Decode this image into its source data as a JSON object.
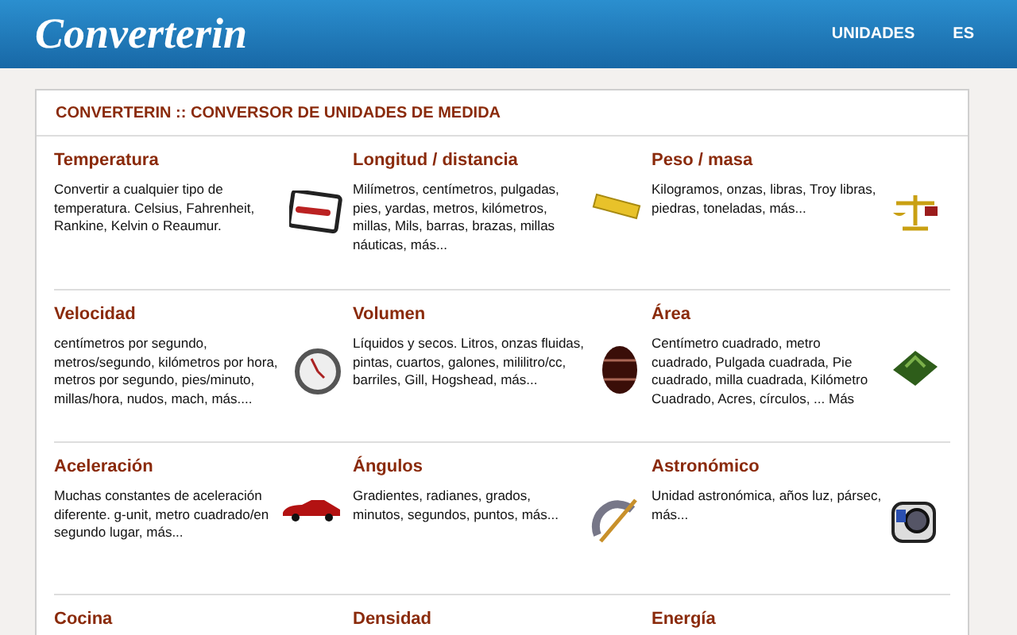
{
  "header": {
    "logo": "Converterin",
    "nav": [
      "UNIDADES",
      "ES"
    ]
  },
  "panel": {
    "title": "CONVERTERIN :: CONVERSOR DE UNIDADES DE MEDIDA",
    "categories": [
      {
        "title": "Temperatura",
        "description": "Convertir a cualquier tipo de temperatura. Celsius, Fahrenheit, Rankine, Kelvin o Reaumur."
      },
      {
        "title": "Longitud / distancia",
        "description": "Milímetros, centímetros, pulgadas, pies, yardas, metros, kilómetros, millas, Mils, barras, brazas, millas náuticas, más..."
      },
      {
        "title": "Peso / masa",
        "description": "Kilogramos, onzas, libras, Troy libras, piedras, toneladas, más..."
      },
      {
        "title": "Velocidad",
        "description": "centímetros por segundo, metros/segundo, kilómetros por hora, metros por segundo, pies/minuto, millas/hora, nudos, mach, más...."
      },
      {
        "title": "Volumen",
        "description": "Líquidos y secos. Litros, onzas fluidas, pintas, cuartos, galones, mililitro/cc, barriles, Gill, Hogshead, más..."
      },
      {
        "title": "Área",
        "description": "Centímetro cuadrado, metro cuadrado, Pulgada cuadrada, Pie cuadrado, milla cuadrada, Kilómetro Cuadrado, Acres, círculos, ... Más"
      },
      {
        "title": "Aceleración",
        "description": "Muchas constantes de aceleración diferente. g-unit, metro cuadrado/en segundo lugar, más..."
      },
      {
        "title": "Ángulos",
        "description": "Gradientes, radianes, grados, minutos, segundos, puntos, más..."
      },
      {
        "title": "Astronómico",
        "description": "Unidad astronómica, años luz, pársec, más..."
      },
      {
        "title": "Cocina"
      },
      {
        "title": "Densidad"
      },
      {
        "title": "Energía"
      }
    ]
  }
}
